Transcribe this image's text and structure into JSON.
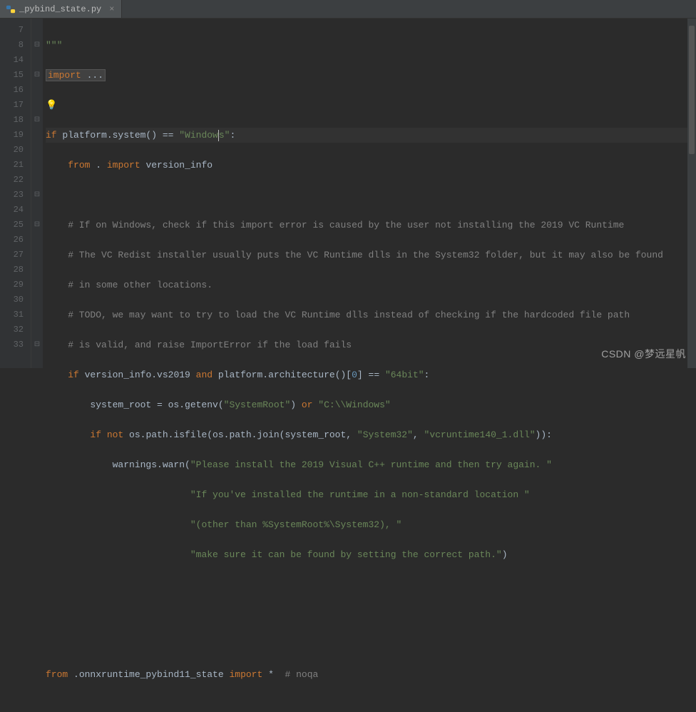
{
  "tab": {
    "filename": "_pybind_state.py"
  },
  "gutter_lines": [
    "7",
    "8",
    "14",
    "15",
    "16",
    "17",
    "18",
    "19",
    "20",
    "21",
    "22",
    "23",
    "24",
    "25",
    "26",
    "27",
    "28",
    "29",
    "30",
    "31",
    "32",
    "33"
  ],
  "fold_marks": [
    "",
    "⊟",
    "",
    "⊟",
    "",
    "",
    "⊟",
    "",
    "",
    "",
    "",
    "⊟",
    "",
    "⊟",
    "",
    "",
    "",
    "",
    "",
    "",
    "",
    "⊟"
  ],
  "code": {
    "l7": "\"\"\"",
    "l8a": "import",
    "l8b": " ...",
    "l15_if": "if",
    "l15_a": " platform.system() == ",
    "l15_s1": "\"Window",
    "l15_s2": "s\"",
    "l15_c": ":",
    "l16_from": "from",
    "l16_dot": " . ",
    "l16_import": "import",
    "l16_v": " version_info",
    "l18": "    # If on Windows, check if this import error is caused by the user not installing the 2019 VC Runtime",
    "l19": "    # The VC Redist installer usually puts the VC Runtime dlls in the System32 folder, but it may also be found",
    "l20": "    # in some other locations.",
    "l21": "    # TODO, we may want to try to load the VC Runtime dlls instead of checking if the hardcoded file path",
    "l22": "    # is valid, and raise ImportError if the load fails",
    "l23_if": "if",
    "l23_a": " version_info.vs2019 ",
    "l23_and": "and",
    "l23_b": " platform.architecture()[",
    "l23_0": "0",
    "l23_c": "] == ",
    "l23_s": "\"64bit\"",
    "l23_d": ":",
    "l24_a": "        system_root = os.getenv(",
    "l24_s1": "\"SystemRoot\"",
    "l24_b": ") ",
    "l24_or": "or",
    "l24_c": " ",
    "l24_s2": "\"C:\\\\Windows\"",
    "l25_if": "if not",
    "l25_a": " os.path.isfile(os.path.join(system_root, ",
    "l25_s1": "\"System32\"",
    "l25_b": ", ",
    "l25_s2": "\"vcruntime140_1.dll\"",
    "l25_c": ")):",
    "l26_a": "            warnings.warn(",
    "l26_s": "\"Please install the 2019 Visual C++ runtime and then try again. \"",
    "l27_s": "\"If you've installed the runtime in a non-standard location \"",
    "l28_s": "\"(other than %SystemRoot%\\System32), \"",
    "l29_s": "\"make sure it can be found by setting the correct path.\"",
    "l29_c": ")",
    "l33_from": "from",
    "l33_mod": " .onnxruntime_pybind11_state ",
    "l33_import": "import",
    "l33_star": " *  ",
    "l33_comment": "# noqa"
  },
  "watermark": "CSDN @梦远星帆"
}
